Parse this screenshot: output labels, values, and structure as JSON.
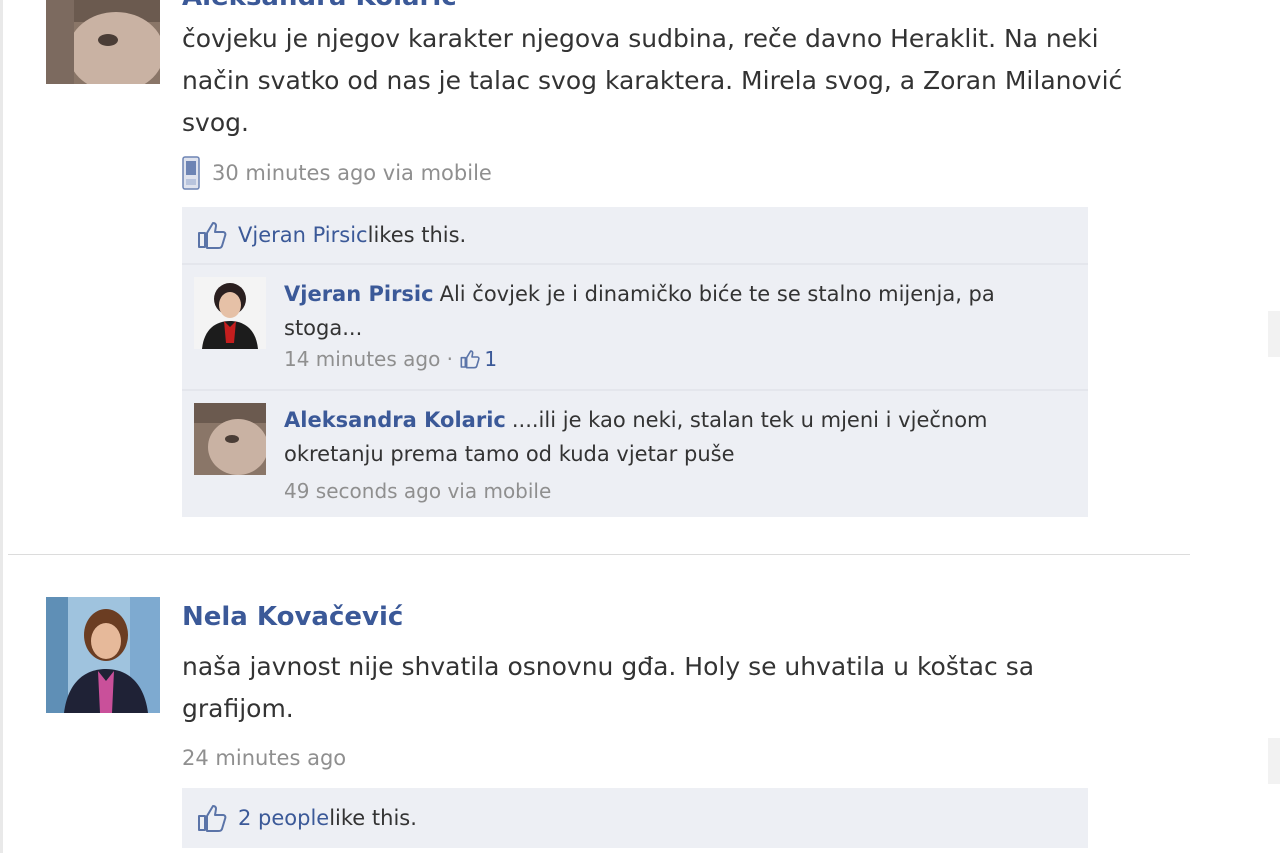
{
  "post1": {
    "author": "Aleksandra Kolaric",
    "text": "čovjeku je njegov karakter njegova sudbina, reče davno Heraklit. Na neki način svatko od nas je talac svog karaktera. Mirela svog, a Zoran Milanović svog.",
    "meta": "30 minutes ago via mobile",
    "likes": {
      "name": "Vjeran Pirsic",
      "suffix": " likes this."
    },
    "comments": [
      {
        "author": "Vjeran Pirsic",
        "text": "Ali čovjek je i dinamičko biće te se stalno mijenja, pa stoga...",
        "meta": "14 minutes ago",
        "sep": " · ",
        "like_count": "1"
      },
      {
        "author": "Aleksandra Kolaric",
        "text": "....ili je kao neki, stalan tek u mjeni i vječnom okretanju prema tamo od kuda vjetar puše",
        "meta": "49 seconds ago via mobile"
      }
    ]
  },
  "post2": {
    "author": "Nela Kovačević",
    "text": "naša javnost nije shvatila osnovnu gđa. Holy se uhvatila u koštac sa grafijom.",
    "meta": "24 minutes ago",
    "likes": {
      "link": "2 people",
      "suffix": " like this."
    }
  },
  "colors": {
    "link": "#3b5998",
    "feedback_bg": "#edeff4",
    "meta": "#8f8f8f"
  }
}
